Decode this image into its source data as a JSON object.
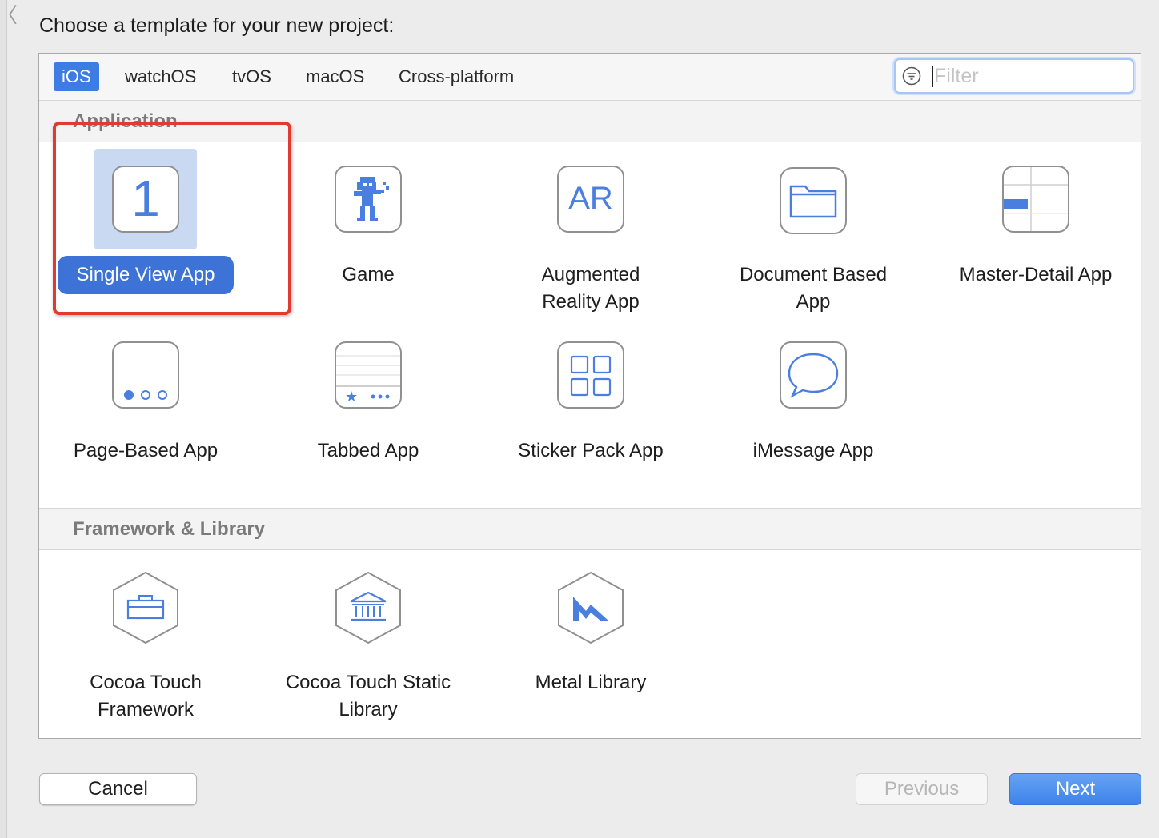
{
  "dialog": {
    "title": "Choose a template for your new project:"
  },
  "platform_tabs": [
    {
      "label": "iOS",
      "selected": true
    },
    {
      "label": "watchOS",
      "selected": false
    },
    {
      "label": "tvOS",
      "selected": false
    },
    {
      "label": "macOS",
      "selected": false
    },
    {
      "label": "Cross-platform",
      "selected": false
    }
  ],
  "filter": {
    "placeholder": "Filter",
    "value": "",
    "icon": "filter-icon"
  },
  "sections": {
    "application": {
      "label": "Application",
      "items": [
        {
          "label": "Single View App",
          "icon": "single-view-icon",
          "icon_text": "1",
          "selected": true
        },
        {
          "label": "Game",
          "icon": "game-icon"
        },
        {
          "label": "Augmented Reality App",
          "icon": "ar-icon",
          "icon_text": "AR"
        },
        {
          "label": "Document Based App",
          "icon": "folder-icon"
        },
        {
          "label": "Master-Detail App",
          "icon": "master-detail-icon"
        },
        {
          "label": "Page-Based App",
          "icon": "page-dots-icon"
        },
        {
          "label": "Tabbed App",
          "icon": "tabbed-icon"
        },
        {
          "label": "Sticker Pack App",
          "icon": "grid-icon"
        },
        {
          "label": "iMessage App",
          "icon": "speech-bubble-icon"
        }
      ]
    },
    "framework": {
      "label": "Framework & Library",
      "items": [
        {
          "label": "Cocoa Touch Framework",
          "icon": "toolbox-icon"
        },
        {
          "label": "Cocoa Touch Static Library",
          "icon": "library-icon"
        },
        {
          "label": "Metal Library",
          "icon": "metal-icon"
        }
      ]
    }
  },
  "footer": {
    "cancel_label": "Cancel",
    "previous_label": "Previous",
    "next_label": "Next"
  },
  "colors": {
    "accent": "#3d7de3",
    "selection_bg": "#c9d9f1",
    "annotation": "#e23a2e",
    "icon_stroke": "#4a7fe0"
  }
}
